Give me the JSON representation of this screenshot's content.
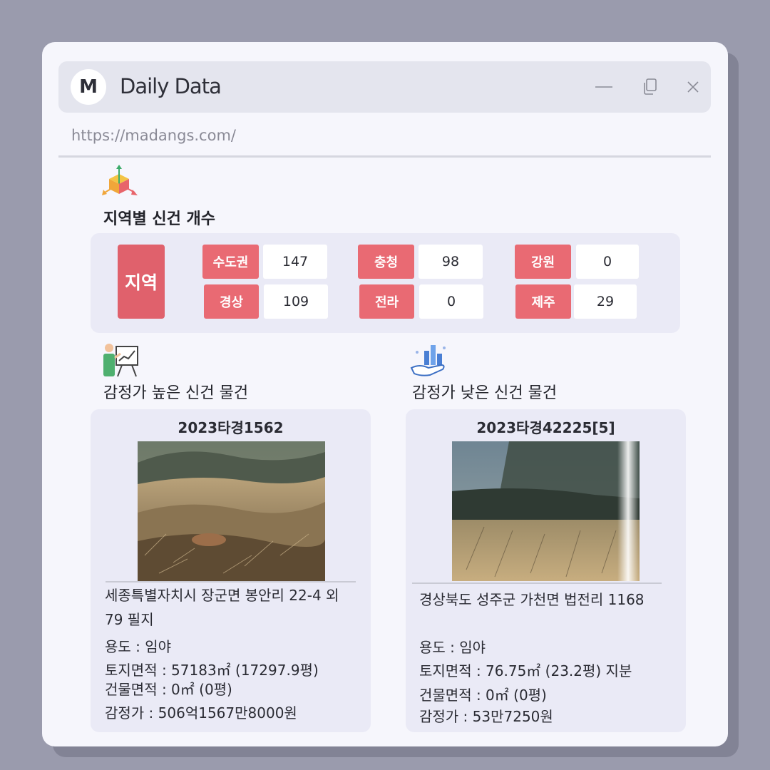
{
  "app": {
    "logo": "M",
    "title": "Daily Data",
    "url": "https://madangs.com/"
  },
  "window_controls": [
    "minimize-icon",
    "restore-icon",
    "close-icon"
  ],
  "region_section": {
    "title": "지역별 신건 개수",
    "main_label": "지역",
    "regions": [
      {
        "name": "수도권",
        "count": "147"
      },
      {
        "name": "충청",
        "count": "98"
      },
      {
        "name": "강원",
        "count": "0"
      },
      {
        "name": "경상",
        "count": "109"
      },
      {
        "name": "전라",
        "count": "0"
      },
      {
        "name": "제주",
        "count": "29"
      }
    ]
  },
  "high_section": {
    "title": "감정가 높은 신건 물건",
    "case_no": "2023타경1562",
    "address": "세종특별자치시 장군면 봉안리 22-4 외 79 필지",
    "usage": "용도 : 임야",
    "land_area": "토지면적 : 57183㎡ (17297.9평)",
    "building_area": "건물면적 : 0㎡ (0평)",
    "appraisal": "감정가 : 506억1567만8000원"
  },
  "low_section": {
    "title": "감정가 낮은 신건 물건",
    "case_no": "2023타경42225[5]",
    "address": "경상북도 성주군 가천면 법전리 1168",
    "usage": "용도 :  임야",
    "land_area": "토지면적 : 76.75㎡ (23.2평) 지분",
    "building_area": "건물면적 : 0㎡ (0평)",
    "appraisal": "감정가 : 53만7250원"
  },
  "colors": {
    "accent_red": "#e96a73",
    "panel": "#eaeaf6",
    "titlebar": "#e4e5ee"
  }
}
